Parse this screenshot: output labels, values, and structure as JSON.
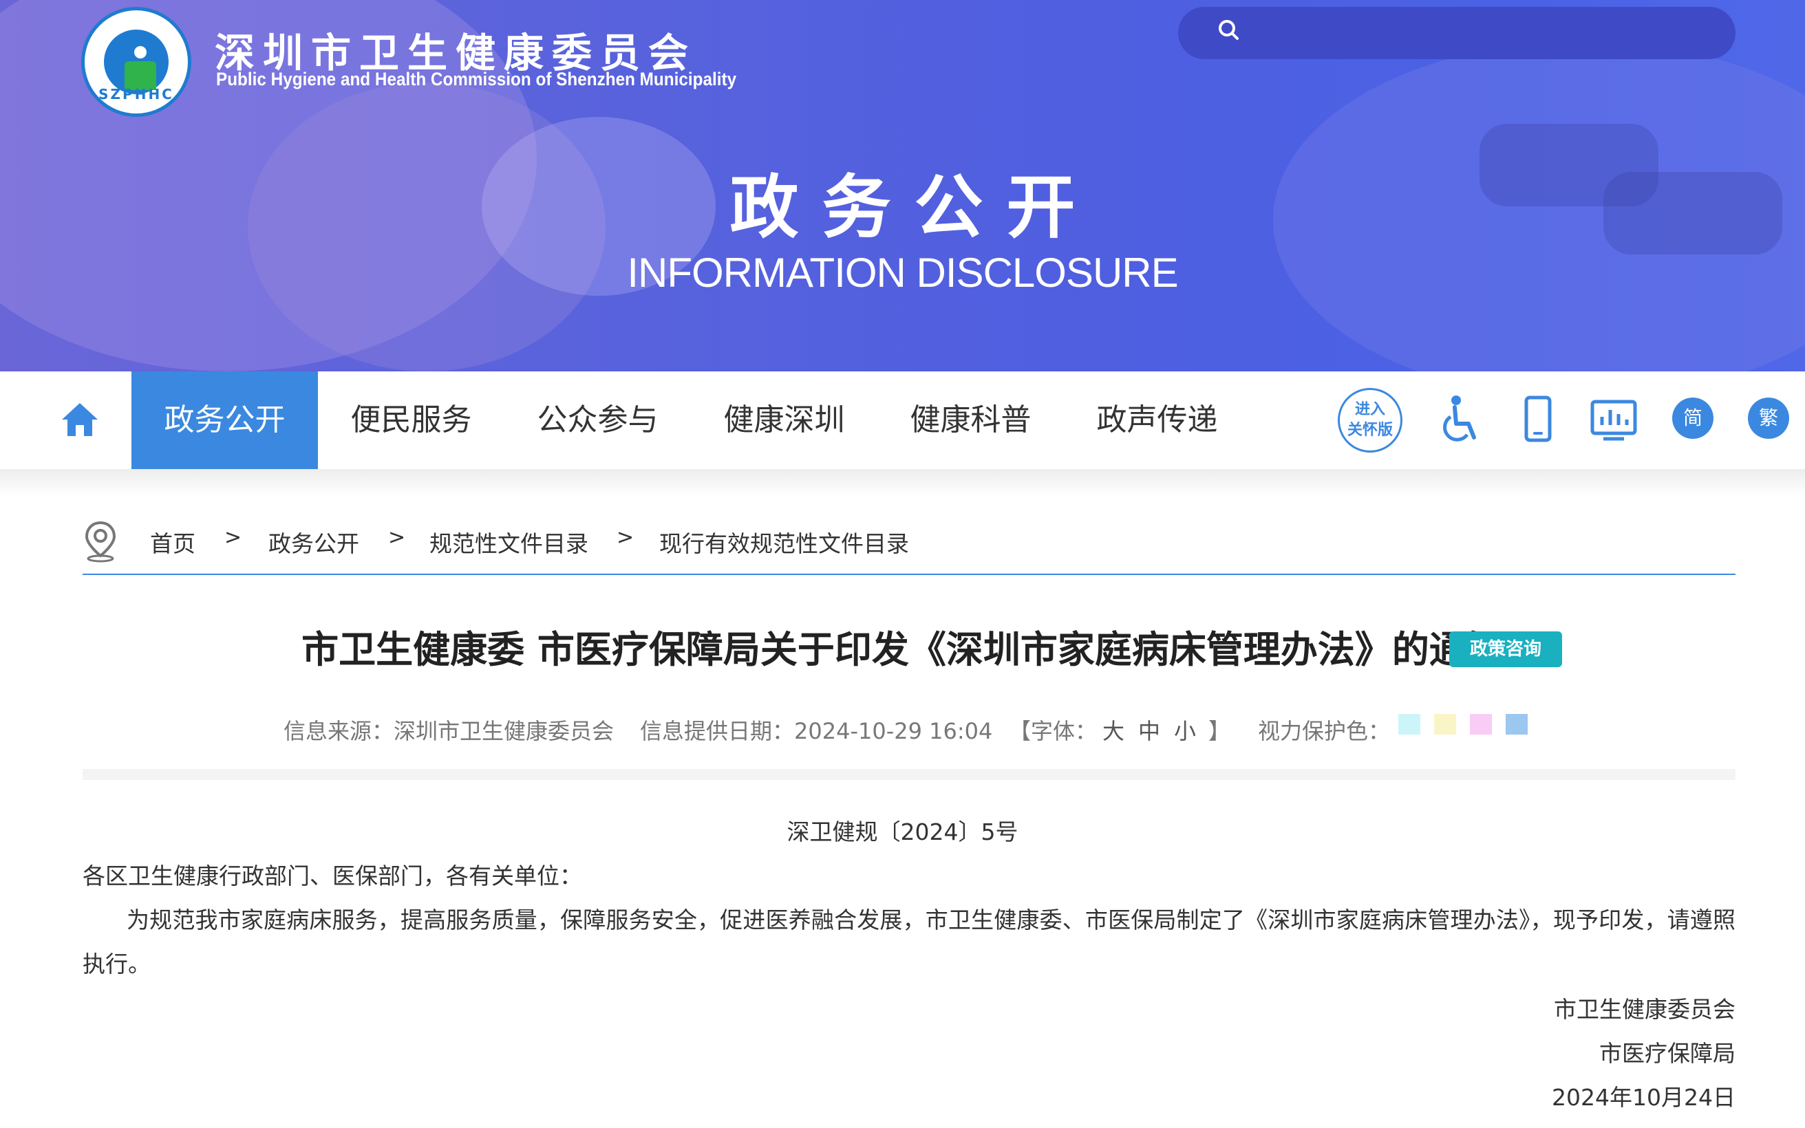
{
  "header": {
    "logo_abbr": "SZPHHC",
    "site_title_cn": "深圳市卫生健康委员会",
    "site_title_en": "Public Hygiene and Health Commission of Shenzhen Municipality",
    "search": {
      "placeholder": "",
      "icon": "search-icon"
    },
    "banner_title_cn": "政务公开",
    "banner_title_en": "INFORMATION DISCLOSURE"
  },
  "nav": {
    "home_icon": "home-icon",
    "items": [
      {
        "label": "政务公开",
        "active": true
      },
      {
        "label": "便民服务",
        "active": false
      },
      {
        "label": "公众参与",
        "active": false
      },
      {
        "label": "健康深圳",
        "active": false
      },
      {
        "label": "健康科普",
        "active": false
      },
      {
        "label": "政声传递",
        "active": false
      }
    ],
    "tools": {
      "care_line1": "进入",
      "care_line2": "关怀版",
      "accessibility_icon": "wheelchair-icon",
      "mobile_icon": "mobile-icon",
      "stats_icon": "chart-icon",
      "simplified": "简",
      "traditional": "繁"
    }
  },
  "breadcrumb": {
    "items": [
      "首页",
      "政务公开",
      "规范性文件目录",
      "现行有效规范性文件目录"
    ],
    "separator": ">"
  },
  "article": {
    "title": "市卫生健康委 市医疗保障局关于印发《深圳市家庭病床管理办法》的通知",
    "badge": "政策咨询",
    "meta": {
      "source": "信息来源：深圳市卫生健康委员会",
      "date": "信息提供日期：2024-10-29 16:04",
      "font_open": "【字体：",
      "font_large": "大",
      "font_medium": "中",
      "font_small": "小",
      "font_close": "】",
      "eye_care_label": "视力保护色："
    },
    "eye_care_colors": [
      "#ccf5f9",
      "#f9f5c7",
      "#f9ccf5",
      "#9cc7ee"
    ],
    "doc_number": "深卫健规〔2024〕5号",
    "salutation": "各区卫生健康行政部门、医保部门，各有关单位：",
    "paragraph": "为规范我市家庭病床服务，提高服务质量，保障服务安全，促进医养融合发展，市卫生健康委、市医保局制定了《深圳市家庭病床管理办法》，现予印发，请遵照执行。",
    "signatures": [
      "市卫生健康委员会",
      "市医疗保障局",
      "2024年10月24日"
    ]
  },
  "colors": {
    "accent": "#3b88e0",
    "badge": "#19b0c0",
    "banner": "#4f5fe0"
  }
}
